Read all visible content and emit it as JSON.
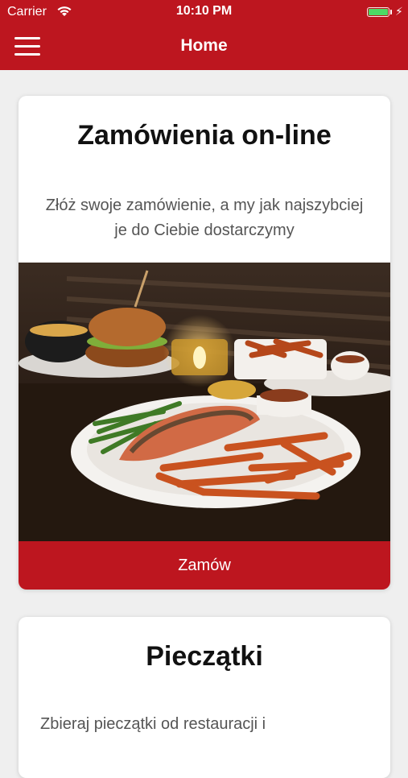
{
  "status_bar": {
    "carrier": "Carrier",
    "time": "10:10 PM"
  },
  "nav": {
    "title": "Home",
    "menu_icon": "hamburger-menu-icon"
  },
  "cards": [
    {
      "title": "Zamówienia on-line",
      "description": "Złóż swoje zamówienie, a my jak najszybciej je do Ciebie dostarczymy",
      "button_label": "Zamów"
    },
    {
      "title": "Pieczątki",
      "description": "Zbieraj pieczątki od restauracji i"
    }
  ],
  "colors": {
    "brand": "#bd161f",
    "battery": "#4cd964",
    "background": "#efefef"
  }
}
